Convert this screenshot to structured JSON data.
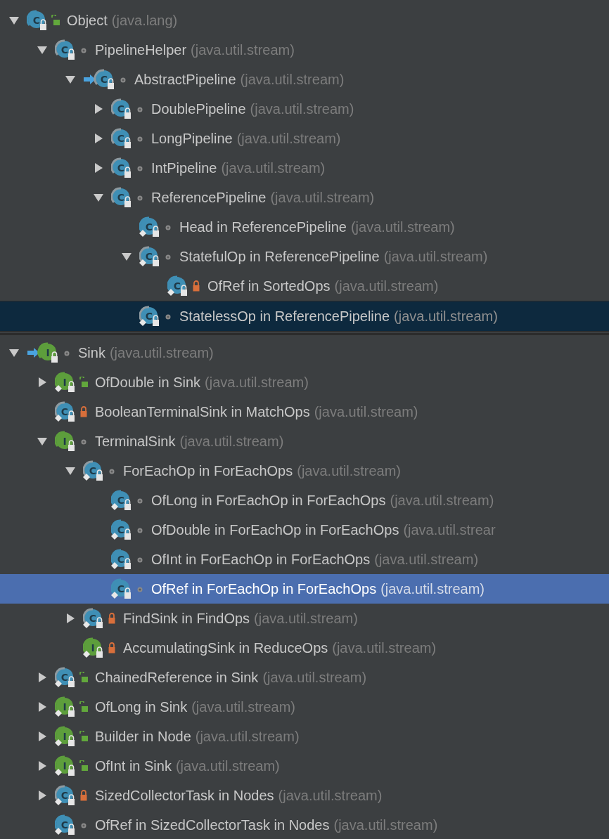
{
  "panels": [
    {
      "focused": false,
      "nodes": [
        {
          "name": "Object",
          "package": "(java.lang)",
          "kind": "class",
          "letter": "C",
          "abstract": false,
          "static": false,
          "base": false,
          "public": true,
          "private": false,
          "expandable": true,
          "expanded": true,
          "selected": false,
          "children": [
            {
              "name": "PipelineHelper",
              "package": "(java.util.stream)",
              "kind": "class",
              "letter": "C",
              "abstract": true,
              "static": false,
              "base": false,
              "public": false,
              "private": false,
              "expandable": true,
              "expanded": true,
              "selected": false,
              "children": [
                {
                  "name": "AbstractPipeline",
                  "package": "(java.util.stream)",
                  "kind": "class",
                  "letter": "C",
                  "abstract": true,
                  "static": false,
                  "base": true,
                  "public": false,
                  "private": false,
                  "expandable": true,
                  "expanded": true,
                  "selected": false,
                  "children": [
                    {
                      "name": "DoublePipeline",
                      "package": "(java.util.stream)",
                      "kind": "class",
                      "letter": "C",
                      "abstract": true,
                      "static": false,
                      "base": false,
                      "public": false,
                      "private": false,
                      "expandable": true,
                      "expanded": false,
                      "selected": false
                    },
                    {
                      "name": "LongPipeline",
                      "package": "(java.util.stream)",
                      "kind": "class",
                      "letter": "C",
                      "abstract": true,
                      "static": false,
                      "base": false,
                      "public": false,
                      "private": false,
                      "expandable": true,
                      "expanded": false,
                      "selected": false
                    },
                    {
                      "name": "IntPipeline",
                      "package": "(java.util.stream)",
                      "kind": "class",
                      "letter": "C",
                      "abstract": true,
                      "static": false,
                      "base": false,
                      "public": false,
                      "private": false,
                      "expandable": true,
                      "expanded": false,
                      "selected": false
                    },
                    {
                      "name": "ReferencePipeline",
                      "package": "(java.util.stream)",
                      "kind": "class",
                      "letter": "C",
                      "abstract": true,
                      "static": false,
                      "base": false,
                      "public": false,
                      "private": false,
                      "expandable": true,
                      "expanded": true,
                      "selected": false,
                      "children": [
                        {
                          "name": "Head in ReferencePipeline",
                          "package": "(java.util.stream)",
                          "kind": "class",
                          "letter": "C",
                          "abstract": false,
                          "static": true,
                          "base": false,
                          "public": false,
                          "private": false,
                          "expandable": false,
                          "selected": false
                        },
                        {
                          "name": "StatefulOp in ReferencePipeline",
                          "package": "(java.util.stream)",
                          "kind": "class",
                          "letter": "C",
                          "abstract": true,
                          "static": true,
                          "base": false,
                          "public": false,
                          "private": false,
                          "expandable": true,
                          "expanded": true,
                          "selected": false,
                          "children": [
                            {
                              "name": "OfRef in SortedOps",
                              "package": "(java.util.stream)",
                              "kind": "class",
                              "letter": "C",
                              "abstract": false,
                              "static": true,
                              "base": false,
                              "private": true,
                              "expandable": false,
                              "selected": false
                            }
                          ]
                        },
                        {
                          "name": "StatelessOp in ReferencePipeline",
                          "package": "(java.util.stream)",
                          "kind": "class",
                          "letter": "C",
                          "abstract": true,
                          "static": true,
                          "base": false,
                          "public": false,
                          "private": false,
                          "expandable": false,
                          "selected": true
                        }
                      ]
                    }
                  ]
                }
              ]
            }
          ]
        }
      ]
    },
    {
      "focused": true,
      "nodes": [
        {
          "name": "Sink",
          "package": "(java.util.stream)",
          "kind": "interface",
          "letter": "I",
          "abstract": false,
          "static": false,
          "base": true,
          "public": false,
          "private": false,
          "expandable": true,
          "expanded": true,
          "selected": false,
          "children": [
            {
              "name": "OfDouble in Sink",
              "package": "(java.util.stream)",
              "kind": "interface",
              "letter": "I",
              "abstract": false,
              "static": true,
              "base": false,
              "public": true,
              "private": false,
              "expandable": true,
              "expanded": false,
              "selected": false
            },
            {
              "name": "BooleanTerminalSink in MatchOps",
              "package": "(java.util.stream)",
              "kind": "class",
              "letter": "C",
              "abstract": true,
              "static": true,
              "base": false,
              "private": true,
              "expandable": false,
              "selected": false
            },
            {
              "name": "TerminalSink",
              "package": "(java.util.stream)",
              "kind": "interface",
              "letter": "I",
              "abstract": false,
              "static": false,
              "base": false,
              "public": false,
              "private": false,
              "expandable": true,
              "expanded": true,
              "selected": false,
              "children": [
                {
                  "name": "ForEachOp in ForEachOps",
                  "package": "(java.util.stream)",
                  "kind": "class",
                  "letter": "C",
                  "abstract": true,
                  "static": true,
                  "base": false,
                  "public": false,
                  "private": false,
                  "expandable": true,
                  "expanded": true,
                  "selected": false,
                  "children": [
                    {
                      "name": "OfLong in ForEachOp in ForEachOps",
                      "package": "(java.util.stream)",
                      "kind": "class",
                      "letter": "C",
                      "abstract": false,
                      "static": true,
                      "base": false,
                      "public": false,
                      "private": false,
                      "expandable": false,
                      "selected": false
                    },
                    {
                      "name": "OfDouble in ForEachOp in ForEachOps",
                      "package": "(java.util.strear",
                      "kind": "class",
                      "letter": "C",
                      "abstract": false,
                      "static": true,
                      "base": false,
                      "public": false,
                      "private": false,
                      "expandable": false,
                      "selected": false
                    },
                    {
                      "name": "OfInt in ForEachOp in ForEachOps",
                      "package": "(java.util.stream)",
                      "kind": "class",
                      "letter": "C",
                      "abstract": false,
                      "static": true,
                      "base": false,
                      "public": false,
                      "private": false,
                      "expandable": false,
                      "selected": false
                    },
                    {
                      "name": "OfRef in ForEachOp in ForEachOps",
                      "package": "(java.util.stream)",
                      "kind": "class",
                      "letter": "C",
                      "abstract": false,
                      "static": true,
                      "base": false,
                      "public": false,
                      "private": false,
                      "expandable": false,
                      "selected": true
                    }
                  ]
                },
                {
                  "name": "FindSink in FindOps",
                  "package": "(java.util.stream)",
                  "kind": "class",
                  "letter": "C",
                  "abstract": true,
                  "static": true,
                  "base": false,
                  "private": true,
                  "expandable": true,
                  "expanded": false,
                  "selected": false
                },
                {
                  "name": "AccumulatingSink in ReduceOps",
                  "package": "(java.util.stream)",
                  "kind": "interface",
                  "letter": "I",
                  "abstract": false,
                  "static": true,
                  "base": false,
                  "private": true,
                  "expandable": false,
                  "selected": false
                }
              ]
            },
            {
              "name": "ChainedReference in Sink",
              "package": "(java.util.stream)",
              "kind": "class",
              "letter": "C",
              "abstract": true,
              "static": true,
              "base": false,
              "public": true,
              "private": false,
              "expandable": true,
              "expanded": false,
              "selected": false
            },
            {
              "name": "OfLong in Sink",
              "package": "(java.util.stream)",
              "kind": "interface",
              "letter": "I",
              "abstract": false,
              "static": true,
              "base": false,
              "public": true,
              "private": false,
              "expandable": true,
              "expanded": false,
              "selected": false
            },
            {
              "name": "Builder in Node",
              "package": "(java.util.stream)",
              "kind": "interface",
              "letter": "I",
              "abstract": false,
              "static": true,
              "base": false,
              "public": true,
              "private": false,
              "expandable": true,
              "expanded": false,
              "selected": false
            },
            {
              "name": "OfInt in Sink",
              "package": "(java.util.stream)",
              "kind": "interface",
              "letter": "I",
              "abstract": false,
              "static": true,
              "base": false,
              "public": true,
              "private": false,
              "expandable": true,
              "expanded": false,
              "selected": false
            },
            {
              "name": "SizedCollectorTask in Nodes",
              "package": "(java.util.stream)",
              "kind": "class",
              "letter": "C",
              "abstract": true,
              "static": true,
              "base": false,
              "private": true,
              "expandable": true,
              "expanded": false,
              "selected": false
            },
            {
              "name": "OfRef in SizedCollectorTask in Nodes",
              "package": "(java.util.stream)",
              "kind": "class",
              "letter": "C",
              "abstract": false,
              "static": true,
              "base": false,
              "public": false,
              "private": false,
              "expandable": false,
              "selected": false
            }
          ]
        }
      ]
    }
  ]
}
